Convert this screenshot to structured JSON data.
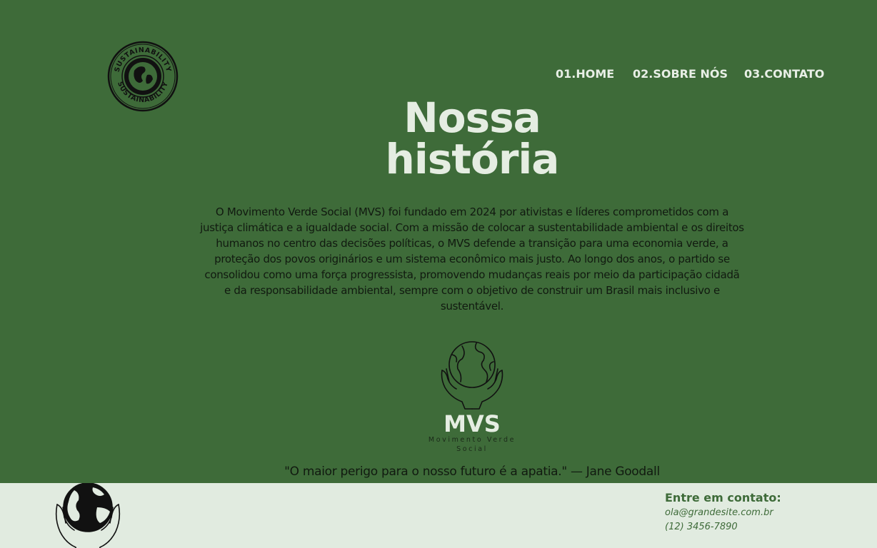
{
  "colors": {
    "background": "#3e6b39",
    "footer_background": "#e1ebe0",
    "light_text": "#e5ede2",
    "dark_text": "#111a10",
    "accent": "#3e6b39"
  },
  "header": {
    "badge_text": "SUSTAINABILITY",
    "nav": [
      {
        "label": "01.HOME"
      },
      {
        "label": "02.SOBRE NÓS"
      },
      {
        "label": "03.CONTATO"
      }
    ]
  },
  "main": {
    "title_line1": "Nossa",
    "title_line2": "história",
    "story": "O Movimento Verde Social (MVS) foi fundado em 2024 por ativistas e líderes comprometidos com a justiça climática e a igualdade social. Com a missão de colocar a sustentabilidade ambiental e os direitos humanos no centro das decisões políticas, o MVS defende a transição para uma economia verde, a proteção dos povos originários e um sistema econômico mais justo. Ao longo dos anos, o partido se consolidou como uma força progressista, promovendo mudanças reais por meio da participação cidadã e da responsabilidade ambiental, sempre com o objetivo de construir um Brasil mais inclusivo e sustentável.",
    "brand_name": "MVS",
    "brand_subtitle": "Movimento Verde Social",
    "quote": "\"O maior perigo para o nosso futuro é a apatia.\" — Jane Goodall"
  },
  "footer": {
    "contact_title": "Entre em contato:",
    "email": "ola@grandesite.com.br",
    "phone": "(12) 3456-7890"
  },
  "icons": [
    "sustainability-badge-icon",
    "globe-hands-icon",
    "globe-hands-filled-icon"
  ]
}
